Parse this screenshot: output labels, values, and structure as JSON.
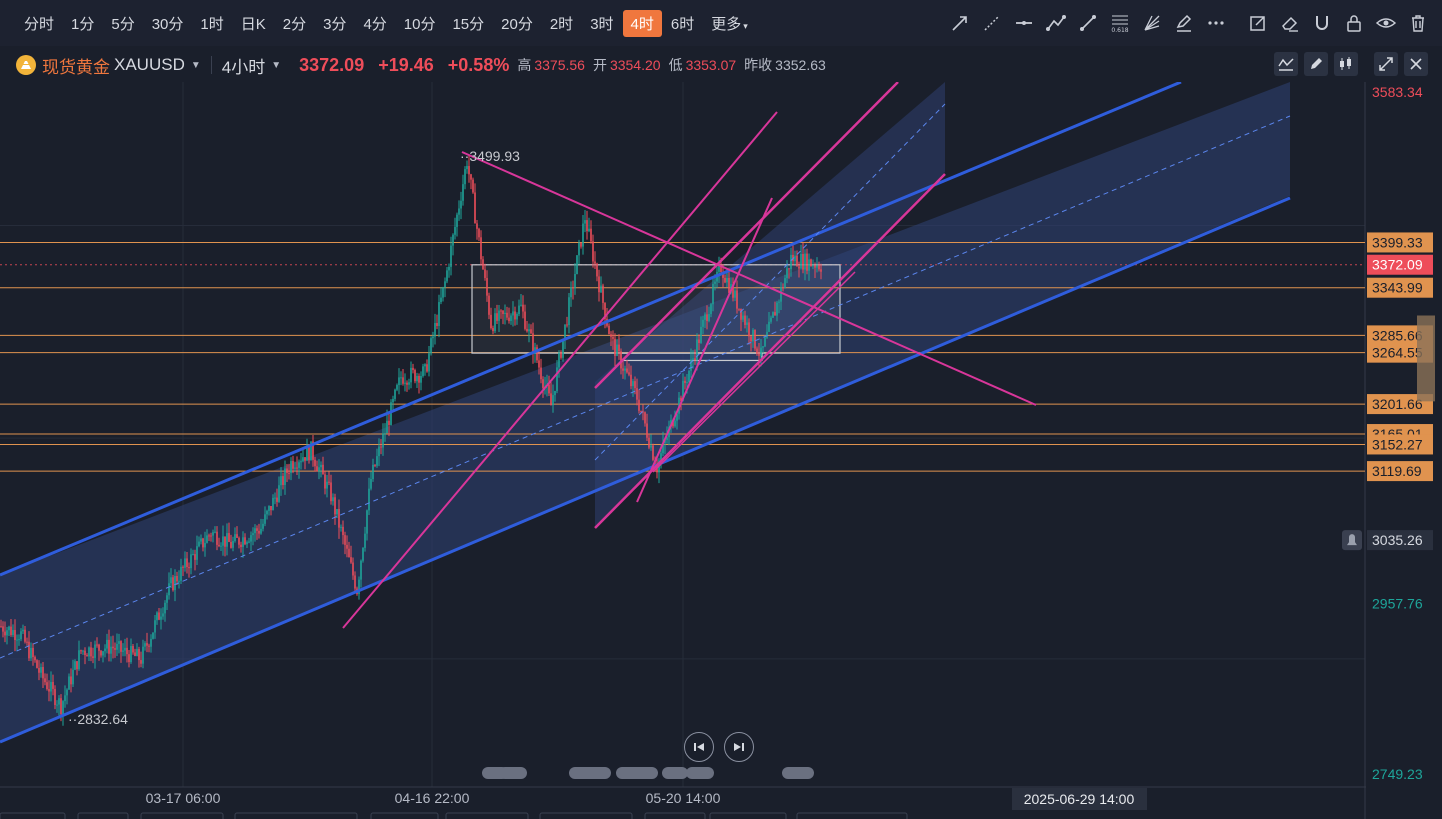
{
  "timeframes": [
    {
      "label": "分时",
      "active": false
    },
    {
      "label": "1分",
      "active": false
    },
    {
      "label": "5分",
      "active": false
    },
    {
      "label": "30分",
      "active": false
    },
    {
      "label": "1时",
      "active": false
    },
    {
      "label": "日K",
      "active": false
    },
    {
      "label": "2分",
      "active": false
    },
    {
      "label": "3分",
      "active": false
    },
    {
      "label": "4分",
      "active": false
    },
    {
      "label": "10分",
      "active": false
    },
    {
      "label": "15分",
      "active": false
    },
    {
      "label": "20分",
      "active": false
    },
    {
      "label": "2时",
      "active": false
    },
    {
      "label": "3时",
      "active": false
    },
    {
      "label": "4时",
      "active": true
    },
    {
      "label": "6时",
      "active": false
    },
    {
      "label": "更多",
      "active": false,
      "dropdown": true
    }
  ],
  "drawing_tools": [
    "arrow-line-icon",
    "ray-icon",
    "horizontal-line-icon",
    "polyline-icon",
    "trend-line-icon",
    "fibonacci-icon",
    "fan-icon",
    "highlighter-icon",
    "more-icon",
    "note-icon",
    "eraser-icon",
    "magnet-icon",
    "lock-icon",
    "eye-icon",
    "trash-icon"
  ],
  "fib_label": "0.618",
  "symbol": {
    "name": "现货黄金",
    "code": "XAUUSD",
    "period": "4小时",
    "price": "3372.09",
    "change": "+19.46",
    "change_pct": "+0.58%",
    "high_label": "高",
    "high": "3375.56",
    "open_label": "开",
    "open": "3354.20",
    "low_label": "低",
    "low": "3353.07",
    "prev_label": "昨收",
    "prev_close": "3352.63"
  },
  "colors": {
    "background": "#1a1f2b",
    "up": "#1ea59a",
    "down": "#ee4d5a",
    "channel": "#2f5ddc",
    "channel_fill": "#2f4275",
    "pink": "#d8369a",
    "level": "#e0934f",
    "active_tab": "#f0773e"
  },
  "price_axis": {
    "min": 2720,
    "max": 3600,
    "plain_labels": [
      {
        "value": 3583.34,
        "text": "3583.34",
        "color": "#ee4d5a"
      },
      {
        "value": 2957.76,
        "text": "2957.76",
        "color": "#1ea59a"
      },
      {
        "value": 2749.23,
        "text": "2749.23",
        "color": "#1ea59a"
      }
    ],
    "level_tags": [
      {
        "value": 3399.33,
        "text": "3399.33"
      },
      {
        "value": 3343.99,
        "text": "3343.99"
      },
      {
        "value": 3285.66,
        "text": "3285.66"
      },
      {
        "value": 3264.55,
        "text": "3264.55"
      },
      {
        "value": 3201.66,
        "text": "3201.66"
      },
      {
        "value": 3165.01,
        "text": "3165.01"
      },
      {
        "value": 3152.27,
        "text": "3152.27"
      },
      {
        "value": 3119.69,
        "text": "3119.69"
      }
    ],
    "current_tag": {
      "value": 3372.09,
      "text": "3372.09"
    },
    "alert_tag": {
      "value": 3035.26,
      "text": "3035.26"
    }
  },
  "time_axis": {
    "labels": [
      "03-17 06:00",
      "04-16 22:00",
      "05-20 14:00"
    ],
    "crosshair_label": "2025-06-29 14:00"
  },
  "annotations": {
    "high": "3499.93",
    "low": "2832.64"
  },
  "chart_data": {
    "type": "candlestick",
    "series_name": "XAUUSD 4小时",
    "anchors": [
      {
        "t": 0,
        "p": 2930
      },
      {
        "t": 10,
        "p": 2920
      },
      {
        "t": 20,
        "p": 2870
      },
      {
        "t": 30,
        "p": 2833
      },
      {
        "t": 40,
        "p": 2900
      },
      {
        "t": 55,
        "p": 2905
      },
      {
        "t": 70,
        "p": 2890
      },
      {
        "t": 85,
        "p": 2980
      },
      {
        "t": 105,
        "p": 3045
      },
      {
        "t": 115,
        "p": 3030
      },
      {
        "t": 130,
        "p": 3050
      },
      {
        "t": 145,
        "p": 3130
      },
      {
        "t": 155,
        "p": 3145
      },
      {
        "t": 165,
        "p": 3090
      },
      {
        "t": 178,
        "p": 2975
      },
      {
        "t": 185,
        "p": 3110
      },
      {
        "t": 200,
        "p": 3235
      },
      {
        "t": 212,
        "p": 3240
      },
      {
        "t": 222,
        "p": 3350
      },
      {
        "t": 233,
        "p": 3500
      },
      {
        "t": 245,
        "p": 3300
      },
      {
        "t": 260,
        "p": 3320
      },
      {
        "t": 275,
        "p": 3200
      },
      {
        "t": 292,
        "p": 3430
      },
      {
        "t": 305,
        "p": 3280
      },
      {
        "t": 318,
        "p": 3210
      },
      {
        "t": 328,
        "p": 3125
      },
      {
        "t": 345,
        "p": 3250
      },
      {
        "t": 360,
        "p": 3370
      },
      {
        "t": 380,
        "p": 3260
      },
      {
        "t": 395,
        "p": 3380
      },
      {
        "t": 410,
        "p": 3372
      }
    ]
  }
}
